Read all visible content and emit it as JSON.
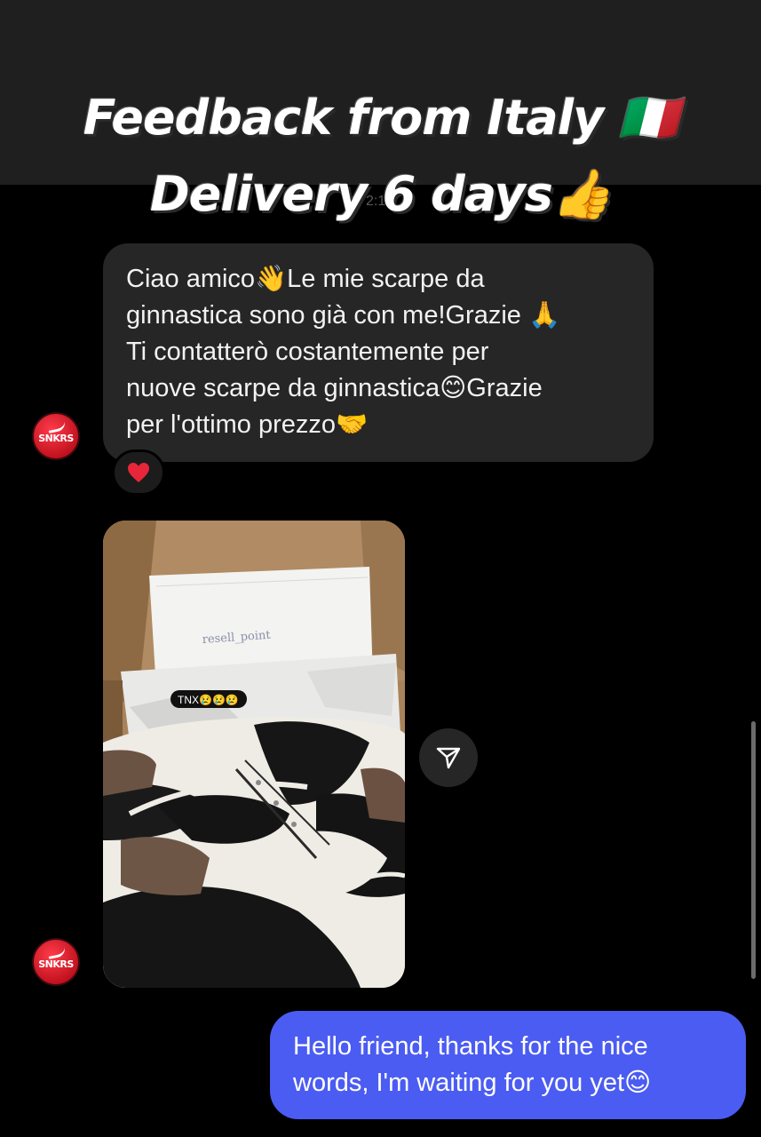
{
  "headline": {
    "line1": "Feedback from Italy 🇮🇹",
    "line2": "Delivery 6 days👍"
  },
  "time_stub": "2:1",
  "messages": {
    "incoming_text": "Ciao amico👋Le mie scarpe da\nginnastica sono già con me!Grazie 🙏\nTi contatterò costantemente per\nnuove scarpe da ginnastica😊Grazie\nper l'ottimo prezzo🤝",
    "reaction": "heart",
    "photo_caption": "TNX😢😢😢",
    "photo_note": "resell_point",
    "outgoing_text": "Hello friend, thanks for the nice\nwords, I'm waiting for you yet😊"
  },
  "avatar": {
    "logo_text": "SNKRS"
  },
  "colors": {
    "outgoing_bubble": "#4b5cf2",
    "incoming_bubble": "#262626",
    "avatar": "#d81b2a"
  },
  "icons": {
    "share": "send-icon",
    "reaction": "heart-icon"
  }
}
